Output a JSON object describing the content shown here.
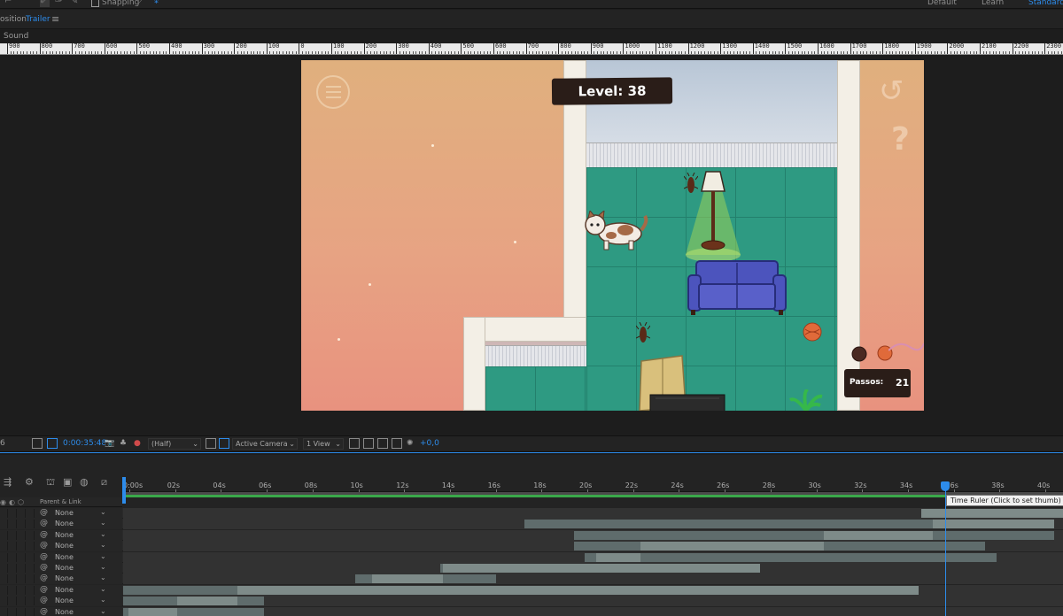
{
  "toolbar": {
    "snapping_label": "Snapping",
    "workspaces": [
      "Default",
      "Learn",
      "Standard"
    ]
  },
  "composition": {
    "tab_prefix": "osition",
    "name": "Trailer",
    "layer_crumb": "Sound"
  },
  "ruler": {
    "labels": [
      "900",
      "800",
      "700",
      "600",
      "500",
      "400",
      "300",
      "200",
      "100",
      "0",
      "100",
      "200",
      "300",
      "400",
      "500",
      "600",
      "700",
      "800",
      "900",
      "1000",
      "1100",
      "1200",
      "1300",
      "1400",
      "1500",
      "1600",
      "1700",
      "1800",
      "1900",
      "2000",
      "2100",
      "2200",
      "2300"
    ]
  },
  "game": {
    "level_text": "Level: 38",
    "steps_label": "Passos:",
    "steps_value": "21",
    "help_symbol": "?",
    "undo_symbol": "↺"
  },
  "viewer_controls": {
    "zoom_fragment": "6",
    "timecode": "0:00:35:48",
    "resolution": "(Half)",
    "camera": "Active Camera",
    "views": "1 View",
    "exposure": "+0,0"
  },
  "timeline": {
    "column_parent_header": "Parent & Link",
    "time_labels": [
      "0:00s",
      "02s",
      "04s",
      "06s",
      "08s",
      "10s",
      "12s",
      "14s",
      "16s",
      "18s",
      "20s",
      "22s",
      "24s",
      "26s",
      "28s",
      "30s",
      "32s",
      "34s",
      "36s",
      "38s",
      "40s"
    ],
    "tooltip": "Time Ruler (Click to set thumb)",
    "current_time_seconds": 35.48,
    "rows": [
      {
        "parent": "None"
      },
      {
        "parent": "None"
      },
      {
        "parent": "None"
      },
      {
        "parent": "None"
      },
      {
        "parent": "None"
      },
      {
        "parent": "None"
      },
      {
        "parent": "None"
      },
      {
        "parent": "None"
      },
      {
        "parent": "None"
      },
      {
        "parent": "None"
      }
    ]
  },
  "colors": {
    "accent": "#2d8ceb",
    "work_area": "#3aa84a",
    "floor": "#2e9a82",
    "sofa": "#4a52b8"
  }
}
